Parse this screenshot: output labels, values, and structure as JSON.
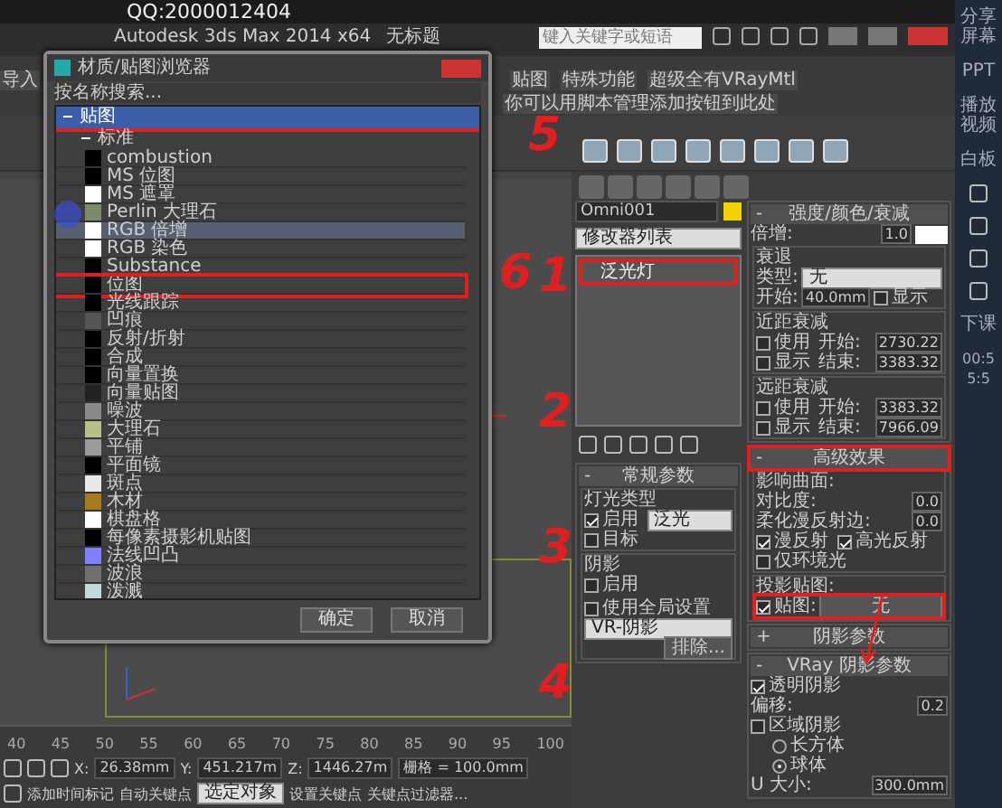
{
  "top_bar": {
    "text": "QQ:2000012404"
  },
  "title_bar": {
    "title": "Autodesk 3ds Max 2014 x64",
    "file": "无标题",
    "search_placeholder": "键入关键字或短语"
  },
  "menu": [
    "导入",
    "贴图",
    "特殊功能",
    "超级全有VRayMtl",
    "你可以用脚本管理添加按钮到此处"
  ],
  "dialog": {
    "title": "材质/贴图浏览器",
    "search_placeholder": "按名称搜索...",
    "group": {
      "label": "贴图",
      "expanded": true,
      "selected": true,
      "annotated": true,
      "subgroup": {
        "label": "标准",
        "expanded": true,
        "items": [
          {
            "label": "combustion",
            "color": "#000000",
            "selected": false,
            "annotated": false
          },
          {
            "label": "MS 位图",
            "color": "#000000",
            "selected": false,
            "annotated": false
          },
          {
            "label": "MS 遮罩",
            "color": "#ffffff",
            "selected": false,
            "annotated": false
          },
          {
            "label": "Perlin 大理石",
            "color": "#7a8a6a",
            "selected": false,
            "annotated": false
          },
          {
            "label": "RGB 倍增",
            "color": "#ffffff",
            "selected": true,
            "annotated": false
          },
          {
            "label": "RGB 染色",
            "color": "#ffffff",
            "selected": false,
            "annotated": false
          },
          {
            "label": "Substance",
            "color": "#000000",
            "selected": false,
            "annotated": false
          },
          {
            "label": "位图",
            "color": "#000000",
            "selected": false,
            "annotated": true
          },
          {
            "label": "光线跟踪",
            "color": "#000000",
            "selected": false,
            "annotated": false
          },
          {
            "label": "凹痕",
            "color": "#555555",
            "selected": false,
            "annotated": false
          },
          {
            "label": "反射/折射",
            "color": "#000000",
            "selected": false,
            "annotated": false
          },
          {
            "label": "合成",
            "color": "#000000",
            "selected": false,
            "annotated": false
          },
          {
            "label": "向量置换",
            "color": "#000000",
            "selected": false,
            "annotated": false
          },
          {
            "label": "向量贴图",
            "color": "#222222",
            "selected": false,
            "annotated": false
          },
          {
            "label": "噪波",
            "color": "#8a8a8a",
            "selected": false,
            "annotated": false
          },
          {
            "label": "大理石",
            "color": "#b8c08a",
            "selected": false,
            "annotated": false
          },
          {
            "label": "平铺",
            "color": "#9a9a9a",
            "selected": false,
            "annotated": false
          },
          {
            "label": "平面镜",
            "color": "#000000",
            "selected": false,
            "annotated": false
          },
          {
            "label": "斑点",
            "color": "#e8e8e8",
            "selected": false,
            "annotated": false
          },
          {
            "label": "木材",
            "color": "#a87a20",
            "selected": false,
            "annotated": false
          },
          {
            "label": "棋盘格",
            "color": "#ffffff",
            "selected": false,
            "annotated": false
          },
          {
            "label": "每像素摄影机贴图",
            "color": "#000000",
            "selected": false,
            "annotated": false
          },
          {
            "label": "法线凹凸",
            "color": "#8080ff",
            "selected": false,
            "annotated": false
          },
          {
            "label": "波浪",
            "color": "#707070",
            "selected": false,
            "annotated": false
          },
          {
            "label": "泼溅",
            "color": "#c0dada",
            "selected": false,
            "annotated": false
          }
        ]
      }
    },
    "buttons": [
      "确定",
      "取消"
    ]
  },
  "command_panel": {
    "object_name": "Omni001",
    "modifier_list": "修改器列表",
    "stack": [
      {
        "label": "泛光灯",
        "annotated": true
      }
    ],
    "left_rollouts": [
      {
        "sign": "-",
        "title": "常规参数",
        "annotated": false,
        "rows": [
          {
            "kind": "group",
            "label": "灯光类型",
            "rows": [
              {
                "kind": "check_dropdown",
                "checked": true,
                "label": "启用",
                "value": "泛光"
              },
              {
                "kind": "checkbox",
                "checked": false,
                "label": "目标"
              }
            ]
          },
          {
            "kind": "group",
            "label": "阴影",
            "rows": [
              {
                "kind": "check_pair",
                "items": [
                  {
                    "checked": false,
                    "label": "启用"
                  },
                  {
                    "checked": false,
                    "label": "使用全局设置"
                  }
                ]
              },
              {
                "kind": "dropdown",
                "value": "VR-阴影"
              },
              {
                "kind": "button",
                "label": "排除..."
              }
            ]
          }
        ]
      }
    ],
    "right_rollouts": [
      {
        "sign": "-",
        "title": "强度/颜色/衰减",
        "annotated": false,
        "rows": [
          {
            "kind": "spinner_swatch",
            "label": "倍增:",
            "value": "1.0"
          },
          {
            "kind": "group",
            "label": "衰退",
            "rows": [
              {
                "kind": "dropdown",
                "label": "类型:",
                "value": "无"
              },
              {
                "kind": "spinner_check",
                "label": "开始:",
                "value": "40.0mm",
                "checked": false,
                "check_label": "显示"
              }
            ]
          },
          {
            "kind": "group",
            "label": "近距衰减",
            "rows": [
              {
                "kind": "check_spinner",
                "checked": false,
                "label": "使用",
                "field": "开始:",
                "value": "2730.22"
              },
              {
                "kind": "check_spinner",
                "checked": false,
                "label": "显示",
                "field": "结束:",
                "value": "3383.32"
              }
            ]
          },
          {
            "kind": "group",
            "label": "远距衰减",
            "rows": [
              {
                "kind": "check_spinner",
                "checked": false,
                "label": "使用",
                "field": "开始:",
                "value": "3383.32"
              },
              {
                "kind": "check_spinner",
                "checked": false,
                "label": "显示",
                "field": "结束:",
                "value": "7966.09"
              }
            ]
          }
        ]
      },
      {
        "sign": "-",
        "title": "高级效果",
        "annotated": true,
        "rows": [
          {
            "kind": "group",
            "label": "影响曲面:",
            "rows": [
              {
                "kind": "spinner",
                "label": "对比度:",
                "value": "0.0"
              },
              {
                "kind": "spinner",
                "label": "柔化漫反射边:",
                "value": "0.0"
              },
              {
                "kind": "check_pair",
                "items": [
                  {
                    "checked": true,
                    "label": "漫反射"
                  },
                  {
                    "checked": true,
                    "label": "高光反射"
                  }
                ]
              },
              {
                "kind": "checkbox",
                "checked": false,
                "label": "仅环境光"
              }
            ]
          },
          {
            "kind": "group",
            "label": "投影贴图:",
            "rows": [
              {
                "kind": "map",
                "checked": true,
                "label": "贴图:",
                "value": "无",
                "annotated": true
              }
            ]
          }
        ]
      },
      {
        "sign": "+",
        "title": "阴影参数",
        "annotated": false
      },
      {
        "sign": "-",
        "title": "VRay 阴影参数",
        "annotated": false,
        "rows": [
          {
            "kind": "checkbox",
            "checked": true,
            "label": "透明阴影"
          },
          {
            "kind": "spinner",
            "label": "偏移:",
            "value": "0.2"
          },
          {
            "kind": "checkbox",
            "checked": false,
            "label": "区域阴影"
          },
          {
            "kind": "radio",
            "selected": false,
            "label": "长方体"
          },
          {
            "kind": "radio",
            "selected": true,
            "label": "球体"
          },
          {
            "kind": "spinner",
            "label": "U 大小:",
            "value": "300.0mm"
          }
        ]
      }
    ]
  },
  "timeline": {
    "ticks": [
      "40",
      "45",
      "50",
      "55",
      "60",
      "65",
      "70",
      "75",
      "80",
      "85",
      "90",
      "95",
      "100"
    ]
  },
  "status_bar": {
    "x_label": "X:",
    "x": "26.38mm",
    "y_label": "Y:",
    "y": "451.217m",
    "z_label": "Z:",
    "z": "1446.27m",
    "grid": "栅格 = 100.0mm",
    "auto_key": "自动关键点",
    "selection": "选定对象",
    "set_key": "设置关键点",
    "key_filters": "关键点过滤器...",
    "add_time_tag": "添加时间标记"
  },
  "right_strip": {
    "items": [
      "分享屏幕",
      "PPT",
      "播放视频",
      "白板"
    ],
    "end_class": "下课",
    "timer": "00:55:5"
  },
  "annotations": [
    "5",
    "6",
    "1",
    "2",
    "3",
    "4"
  ]
}
